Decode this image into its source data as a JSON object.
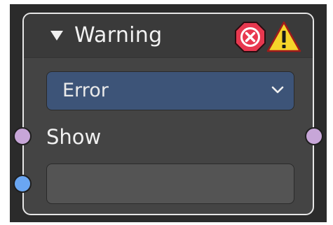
{
  "node": {
    "title": "Warning",
    "status_icons": [
      "error-icon",
      "warning-icon"
    ],
    "mode_dropdown": {
      "selected": "Error"
    },
    "show_label": "Show",
    "message_field": {
      "value": ""
    }
  },
  "colors": {
    "node_background": "#444444",
    "header_background": "#3a3a3a",
    "dropdown_background": "#3d5478",
    "socket_boolean": "#c7a6d8",
    "socket_string": "#6aa6f2",
    "error_red": "#e8384f",
    "warning_yellow": "#f6d42a"
  }
}
